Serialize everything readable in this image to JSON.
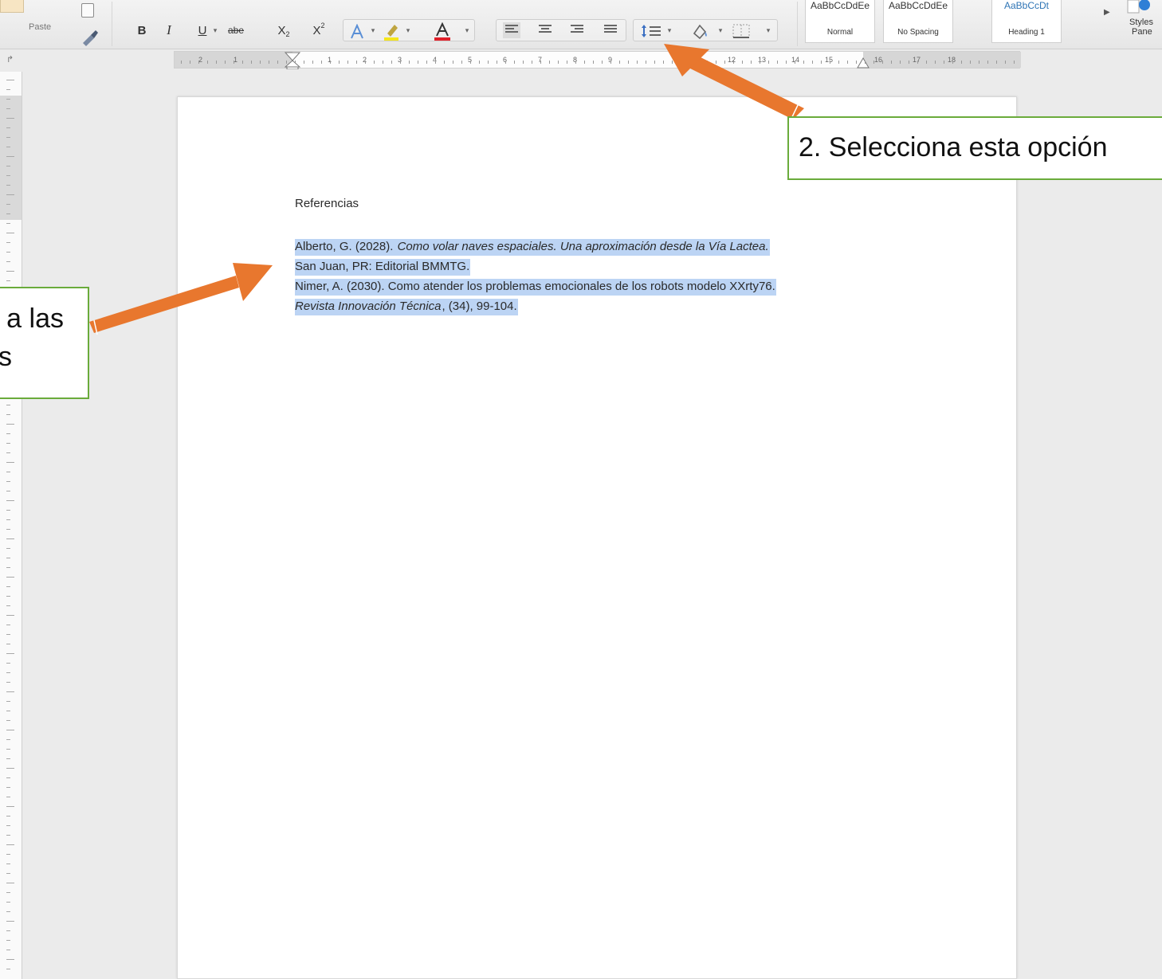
{
  "ribbon": {
    "paste_label": "Paste",
    "copy_icon": "copy-icon",
    "brush_icon": "format-painter-icon",
    "format": {
      "bold": "B",
      "italic": "I",
      "underline": "U",
      "strikethrough": "abe",
      "subscript_base": "X",
      "subscript_mark": "2",
      "superscript_base": "X",
      "superscript_mark": "2"
    },
    "styles": [
      {
        "sample": "AaBbCcDdEe",
        "name": "Normal"
      },
      {
        "sample": "AaBbCcDdEe",
        "name": "No Spacing"
      },
      {
        "sample": "AaBbCcDt",
        "name": "Heading 1"
      }
    ],
    "styles_pane_label_1": "Styles",
    "styles_pane_label_2": "Pane"
  },
  "ruler": {
    "numbers": [
      "2",
      "1",
      "1",
      "2",
      "3",
      "4",
      "5",
      "6",
      "7",
      "8",
      "9",
      "12",
      "13",
      "14",
      "15",
      "16",
      "17",
      "18"
    ]
  },
  "document": {
    "heading": "Referencias",
    "ref1_line1_plain": "Alberto, G. (2028). ",
    "ref1_line1_italic": "Como volar naves espaciales. Una aproximación desde la Vía Lactea.",
    "ref1_line2": "San Juan, PR: Editorial BMMTG.",
    "ref2_line1": "Nimer, A. (2030). Como atender los problemas emocionales de los robots modelo XXrty76.",
    "ref2_line2_italic": "Revista Innovación Técnica",
    "ref2_line2_plain": ", (34), 99-104."
  },
  "annotations": {
    "callout_2": "2. Selecciona esta opción",
    "callout_1_line1": "a las",
    "callout_1_line2": "s"
  },
  "colors": {
    "arrow": "#e8772e",
    "callout_border": "#6aab3b",
    "selection": "#bcd4f4",
    "font_color_bar": "#e0202a",
    "highlight_bar": "#f5e61b"
  }
}
